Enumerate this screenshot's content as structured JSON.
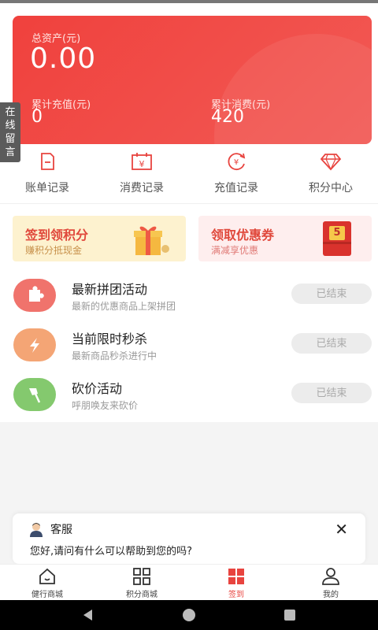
{
  "balance": {
    "total_label": "总资产(元)",
    "total_value": "0.00",
    "recharge_label": "累计充值(元)",
    "recharge_value": "0",
    "consume_label": "累计消费(元)",
    "consume_value": "420"
  },
  "side_tab": {
    "label": "在线留言"
  },
  "quick_menu": [
    {
      "label": "账单记录",
      "icon": "bill-icon"
    },
    {
      "label": "消费记录",
      "icon": "calendar-yen-icon"
    },
    {
      "label": "充值记录",
      "icon": "recharge-icon"
    },
    {
      "label": "积分中心",
      "icon": "diamond-icon"
    }
  ],
  "promos": {
    "sign": {
      "title": "签到领积分",
      "subtitle": "赚积分抵现金"
    },
    "coupon": {
      "title": "领取优惠券",
      "subtitle": "满减享优惠",
      "badge": "5"
    }
  },
  "activities": [
    {
      "title": "最新拼团活动",
      "subtitle": "最新的优惠商品上架拼团",
      "status": "已结束",
      "color": "#f0736c"
    },
    {
      "title": "当前限时秒杀",
      "subtitle": "最新商品秒杀进行中",
      "status": "已结束",
      "color": "#f4a575"
    },
    {
      "title": "砍价活动",
      "subtitle": "呼朋唤友来砍价",
      "status": "已结束",
      "color": "#84c96e"
    }
  ],
  "chat": {
    "title": "客服",
    "close": "✕",
    "message": "您好,请问有什么可以帮助到您的吗?"
  },
  "tabbar": [
    {
      "label": "健行商城",
      "icon": "home-icon"
    },
    {
      "label": "积分商城",
      "icon": "grid-icon"
    },
    {
      "label": "签到",
      "icon": "checkin-icon",
      "active": true
    },
    {
      "label": "我的",
      "icon": "user-icon"
    }
  ],
  "colors": {
    "accent": "#e8443f",
    "card": "#f0413d"
  }
}
